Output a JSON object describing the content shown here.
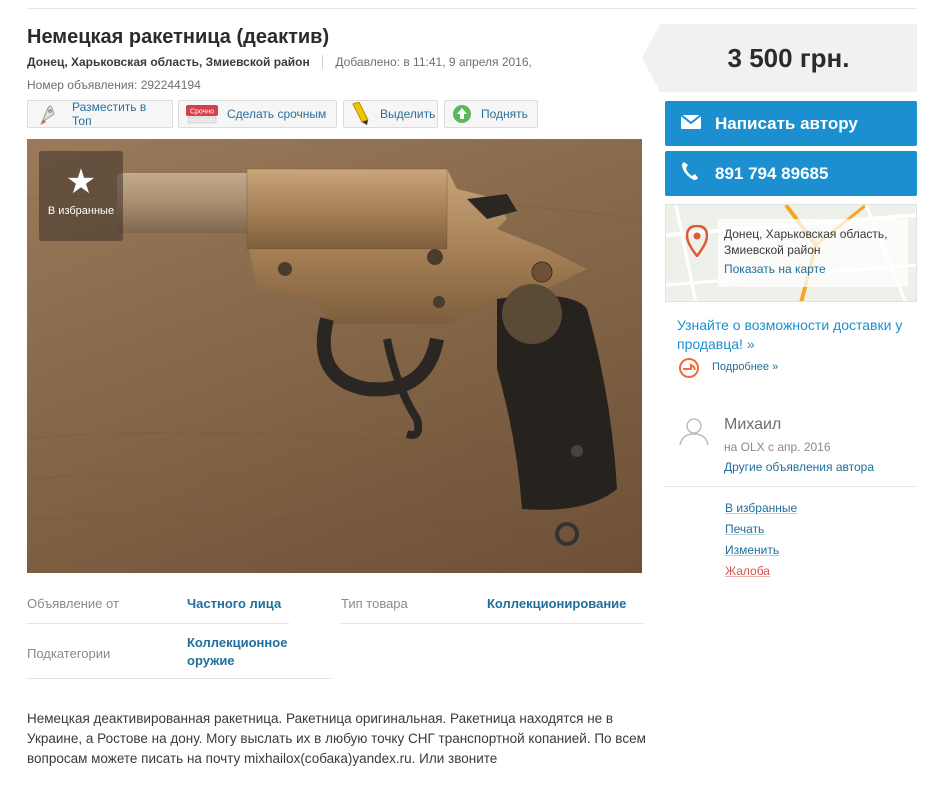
{
  "title": "Немецкая ракетница (деактив)",
  "meta": {
    "location": "Донец, Харьковская область, Змиевской район",
    "added": "Добавлено: в 11:41, 9 апреля 2016,",
    "ad_number": "Номер объявления: 292244194"
  },
  "promo": {
    "top": "Разместить в Топ",
    "urgent": "Сделать срочным",
    "urgent_tag": "Срочно",
    "highlight": "Выделить",
    "raise": "Поднять"
  },
  "photo": {
    "fav_label": "В избранные"
  },
  "details": [
    {
      "key": "Объявление от",
      "value": "Частного лица"
    },
    {
      "key": "Тип товара",
      "value": "Коллекционирование"
    },
    {
      "key": "Подкатегории",
      "value": "Коллекционное оружие"
    }
  ],
  "description": "Немецкая деактивированная ракетница. Ракетница оригинальная. Ракетница находятся не в Украине, а Ростове на дону. Могу выслать их в любую точку СНГ транспортной копанией. По всем вопросам можете писать на почту mixhailox(собака)yandex.ru. Или звоните",
  "price": "3 500 грн.",
  "buttons": {
    "message": "Написать автору",
    "phone": "891 794 89685"
  },
  "map": {
    "address": "Донец, Харьковская область, Змиевской район",
    "show": "Показать на карте"
  },
  "delivery": {
    "text": "Узнайте о возможности доставки у продавца! »",
    "more": "Подробнее »"
  },
  "seller": {
    "name": "Михаил",
    "since": "на OLX с апр. 2016",
    "other": "Другие объявления автора"
  },
  "actions": {
    "favorite": "В избранные",
    "print": "Печать",
    "edit": "Изменить",
    "report": "Жалоба"
  },
  "colors": {
    "accent_blue": "#1c8fd0",
    "link": "#1f6f9c",
    "report_red": "#d9534f"
  }
}
